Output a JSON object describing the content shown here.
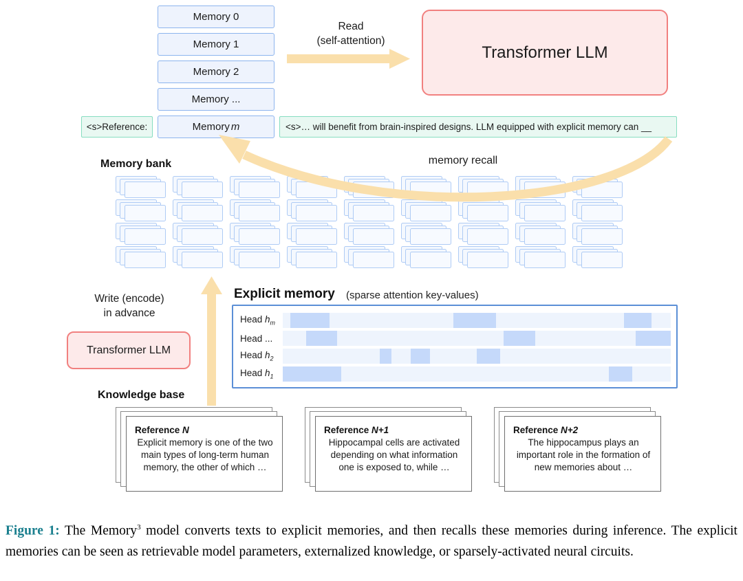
{
  "figure": {
    "memories": [
      {
        "label": "Memory 0",
        "italic": ""
      },
      {
        "label": "Memory 1",
        "italic": ""
      },
      {
        "label": "Memory 2",
        "italic": ""
      },
      {
        "label": "Memory ...",
        "italic": ""
      },
      {
        "label": "Memory ",
        "italic": "m"
      }
    ],
    "tokens": {
      "reference": "<s>Reference:",
      "prompt": "<s>… will benefit from brain-inspired designs. LLM equipped with explicit memory can __"
    },
    "llm_top_label": "Transformer LLM",
    "llm_bottom_label": "Transformer LLM",
    "read_label": "Read\n(self-attention)",
    "recall_label": "memory recall",
    "write_label": "Write (encode)\nin advance",
    "memory_bank_label": "Memory bank",
    "knowledge_base_label": "Knowledge base",
    "explicit_memory_label": "Explicit memory",
    "explicit_memory_sub": "(sparse attention key-values)",
    "memory_bank_grid": {
      "columns": 9,
      "rows": 4,
      "cards_per_stack": 3
    },
    "heads": [
      {
        "name": "Head ",
        "sub": "h",
        "subscript": "m",
        "segments": [
          [
            2,
            10
          ],
          [
            44,
            11
          ],
          [
            88,
            7
          ]
        ]
      },
      {
        "name": "Head ",
        "sub": "",
        "subscript": "",
        "plain": "Head ...",
        "segments": [
          [
            6,
            8
          ],
          [
            57,
            8
          ],
          [
            91,
            9
          ]
        ]
      },
      {
        "name": "Head ",
        "sub": "h",
        "subscript": "2",
        "segments": [
          [
            25,
            3
          ],
          [
            33,
            5
          ],
          [
            50,
            6
          ]
        ]
      },
      {
        "name": "Head ",
        "sub": "h",
        "subscript": "1",
        "segments": [
          [
            0,
            15
          ],
          [
            84,
            6
          ]
        ]
      }
    ],
    "references": [
      {
        "title_prefix": "Reference ",
        "title_var": "N",
        "body": "Explicit memory is one of the two main types of long-term human memory, the other of which …"
      },
      {
        "title_prefix": "Reference ",
        "title_var": "N+1",
        "body": "Hippocampal cells are activated depending on what information one is exposed to, while …"
      },
      {
        "title_prefix": "Reference ",
        "title_var": "N+2",
        "body": "The hippocampus plays an important role in the formation of new memories about …"
      }
    ]
  },
  "caption": {
    "label": "Figure 1:",
    "text_part1": " The Memory",
    "superscript": "3",
    "text_part2": " model converts texts to explicit memories, and then recalls these memories during inference. The explicit memories can be seen as retrievable model parameters, externalized knowledge, or sparsely-activated neural circuits."
  },
  "colors": {
    "memory_fill": "#eef3fd",
    "memory_border": "#8cb4ee",
    "token_fill": "#e9f8f2",
    "token_border": "#86ddc0",
    "llm_fill": "#fdeaea",
    "llm_border": "#f1807f",
    "arrow": "#fadfab",
    "panel_border": "#5b8fd6",
    "head_track": "#eef4fd",
    "head_segment": "#c5d9fa",
    "bank_card_fill": "#f4f8fe",
    "bank_card_border": "#aecbf5",
    "caption_label": "#1a7f8e"
  }
}
